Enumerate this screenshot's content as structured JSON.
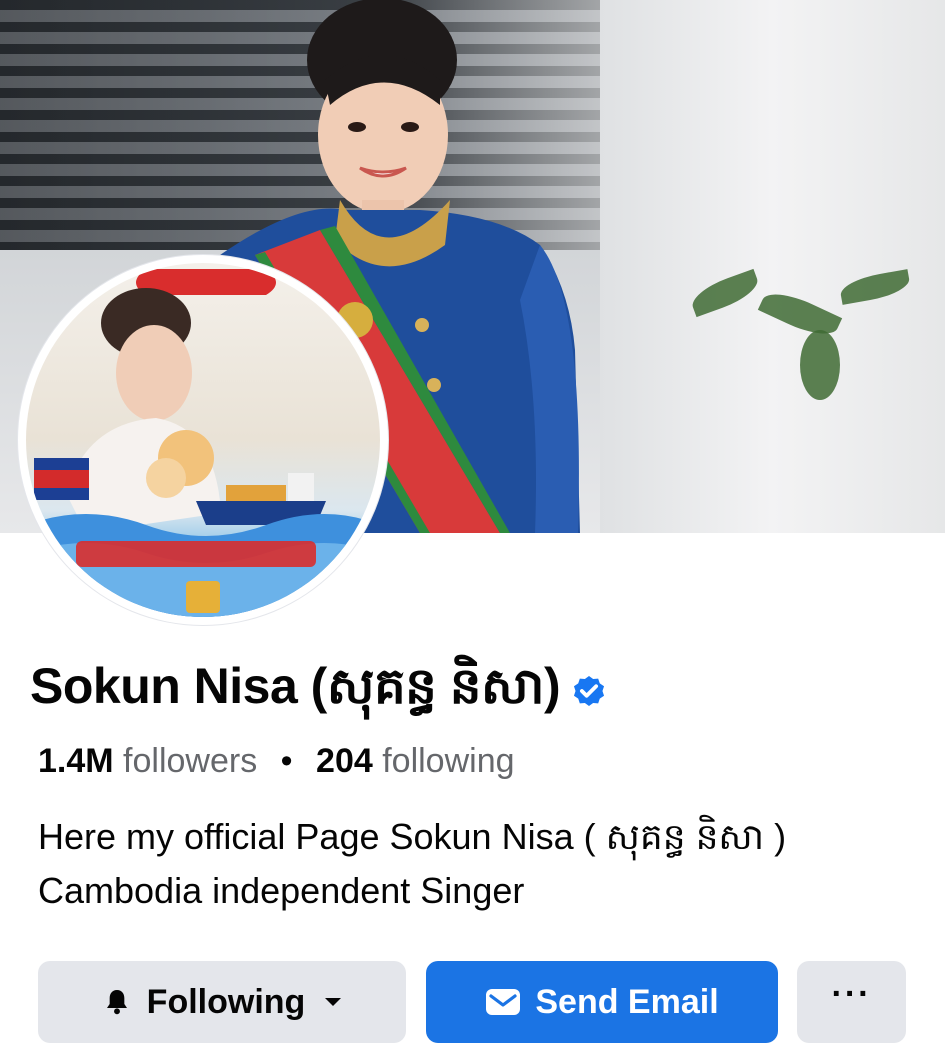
{
  "profile": {
    "name": "Sokun Nisa (សុគន្ធ និសា)",
    "verified": true,
    "followers_count": "1.4M",
    "followers_label": "followers",
    "separator": "•",
    "following_count": "204",
    "following_label": "following",
    "bio": "Here my official Page Sokun Nisa ( សុគន្ធ និសា ) Cambodia independent Singer"
  },
  "actions": {
    "following_label": "Following",
    "send_email_label": "Send Email",
    "more_label": "···"
  },
  "icons": {
    "verified": "verified-badge-icon",
    "bell": "bell-icon",
    "caret": "caret-down-icon",
    "mail": "mail-icon",
    "more": "more-dots-icon"
  },
  "colors": {
    "primary": "#1b74e4",
    "secondary_button": "#e4e6eb",
    "verified_badge": "#1877f2",
    "text_primary": "#050505",
    "text_secondary": "#65676b"
  }
}
